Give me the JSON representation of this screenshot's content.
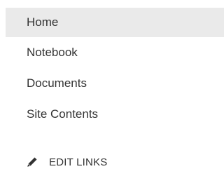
{
  "nav": {
    "items": [
      {
        "label": "Home",
        "selected": true
      },
      {
        "label": "Notebook",
        "selected": false
      },
      {
        "label": "Documents",
        "selected": false
      },
      {
        "label": "Site Contents",
        "selected": false
      }
    ]
  },
  "edit_links": {
    "label": "EDIT LINKS",
    "icon": "pencil-icon"
  },
  "colors": {
    "selected_background": "#eaeaea",
    "text": "#333333"
  }
}
